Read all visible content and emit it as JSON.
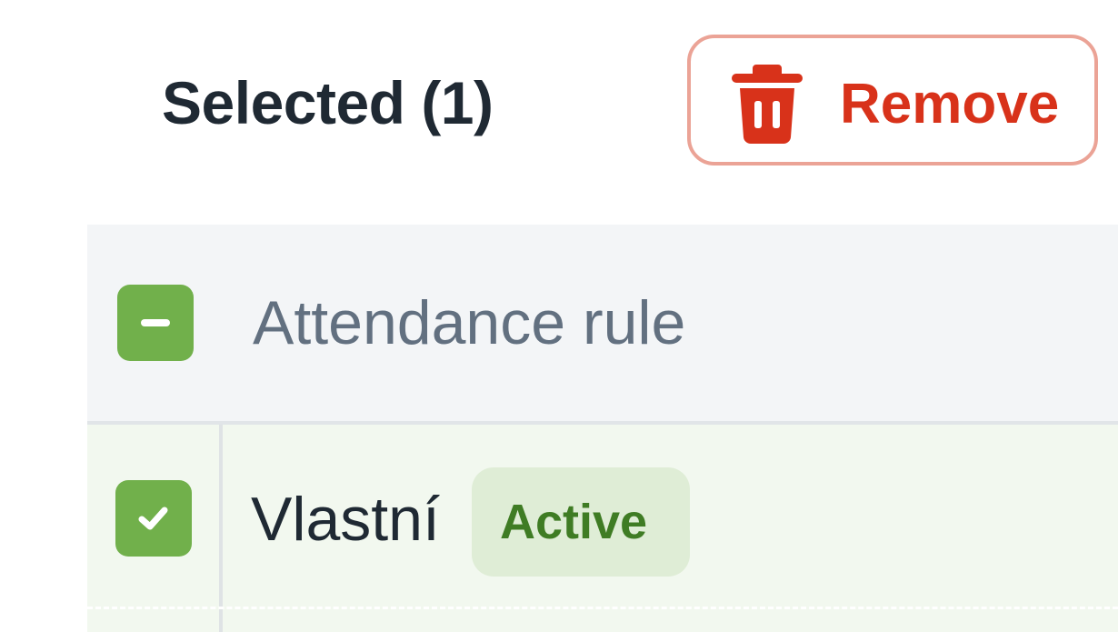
{
  "selection": {
    "label": "Selected (1)",
    "remove_label": "Remove",
    "remove_icon": "trash-icon"
  },
  "table": {
    "header": {
      "column_title": "Attendance rule",
      "checkbox_state": "indeterminate"
    },
    "rows": [
      {
        "name": "Vlastní",
        "status": "Active",
        "checked": true
      }
    ]
  },
  "colors": {
    "accent_green": "#71b04b",
    "danger_red": "#d8321a",
    "badge_bg": "#dfedd6",
    "badge_text": "#3f7c24"
  }
}
